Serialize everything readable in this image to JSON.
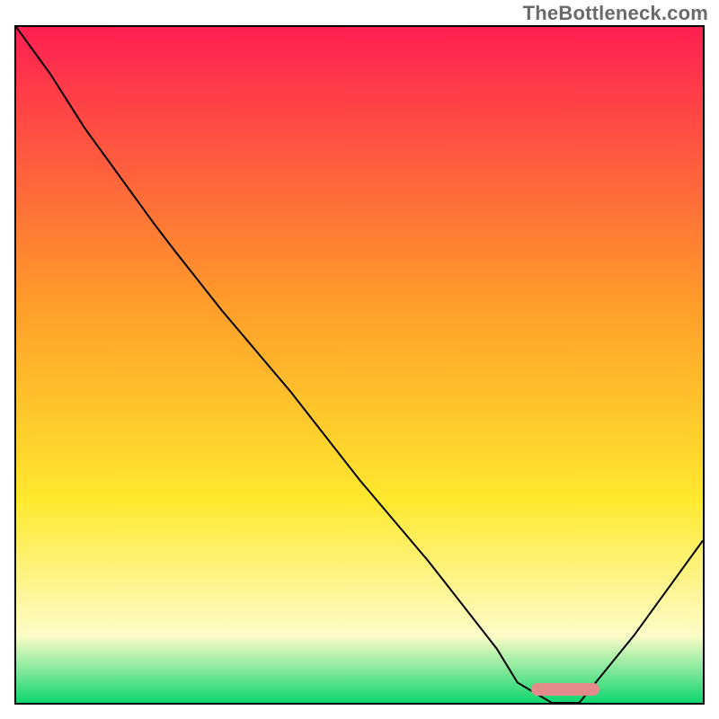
{
  "watermark": "TheBottleneck.com",
  "colors": {
    "top": "#ff1f52",
    "mid_orange": "#ff9a2a",
    "yellow": "#ffe92e",
    "pale_yellow": "#fefcc8",
    "green": "#0ed66e",
    "curve": "#000000",
    "marker": "#e38a8a",
    "border": "#000000"
  },
  "chart_data": {
    "type": "line",
    "title": "",
    "xlabel": "",
    "ylabel": "",
    "xlim": [
      0,
      100
    ],
    "ylim": [
      0,
      100
    ],
    "x": [
      0,
      5,
      10,
      15,
      20,
      23,
      30,
      40,
      50,
      60,
      70,
      73,
      78,
      82,
      90,
      100
    ],
    "values": [
      100,
      93,
      85,
      78,
      71,
      67,
      58,
      46,
      33,
      21,
      8,
      3,
      0,
      0,
      10,
      24
    ],
    "gradient_stops": [
      {
        "pos": 0,
        "color": "#ff1f52"
      },
      {
        "pos": 40,
        "color": "#ff9a2a"
      },
      {
        "pos": 70,
        "color": "#ffe92e"
      },
      {
        "pos": 90,
        "color": "#fefcc8"
      },
      {
        "pos": 100,
        "color": "#0ed66e"
      }
    ],
    "optimal_range_x": [
      75,
      85
    ],
    "marker_y": 1
  }
}
